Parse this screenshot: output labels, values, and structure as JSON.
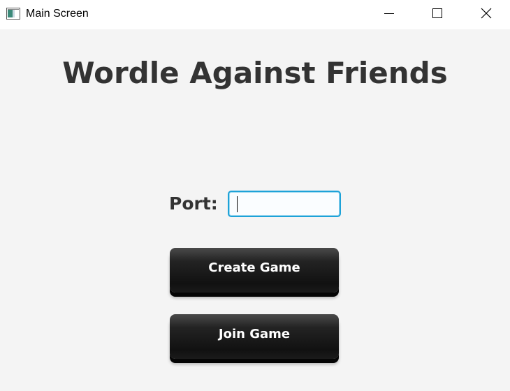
{
  "window": {
    "title": "Main Screen",
    "controls": [
      "minimize-icon",
      "maximize-icon",
      "close-icon"
    ]
  },
  "main": {
    "heading": "Wordle Against Friends",
    "port": {
      "label": "Port:",
      "value": "",
      "placeholder": ""
    },
    "buttons": {
      "create": "Create Game",
      "join": "Join Game"
    }
  },
  "colors": {
    "background": "#f4f4f4",
    "heading_text": "#333333",
    "input_focus_border": "#1da2d8",
    "button_background": "#1a1a1a",
    "button_text": "#ffffff"
  }
}
